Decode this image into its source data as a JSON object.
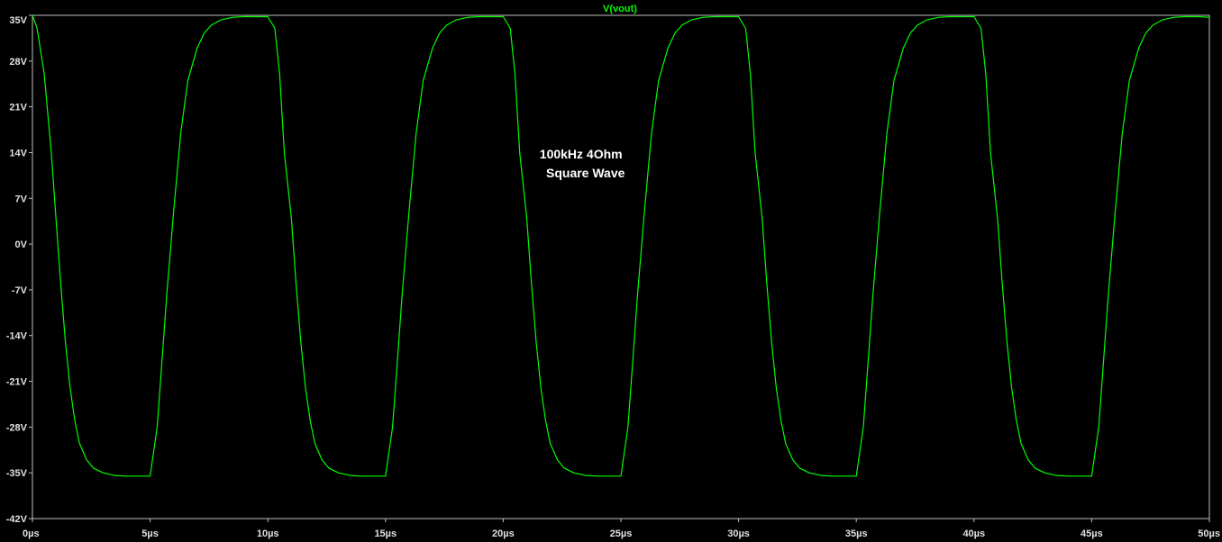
{
  "chart_data": {
    "type": "line",
    "title": "V(vout)",
    "annotation": [
      "100kHz 4Ohm",
      "Square Wave"
    ],
    "xlabel": "",
    "ylabel": "",
    "xlim": [
      0,
      50
    ],
    "ylim": [
      -42,
      35
    ],
    "x_ticks": [
      0,
      5,
      10,
      15,
      20,
      25,
      30,
      35,
      40,
      45,
      50
    ],
    "x_tick_labels": [
      "0µs",
      "5µs",
      "10µs",
      "15µs",
      "20µs",
      "25µs",
      "30µs",
      "35µs",
      "40µs",
      "45µs",
      "50µs"
    ],
    "y_ticks": [
      35,
      28,
      21,
      14,
      7,
      0,
      -7,
      -14,
      -21,
      -28,
      -35,
      -42
    ],
    "y_tick_labels": [
      "35V",
      "28V",
      "21V",
      "14V",
      "7V",
      "0V",
      "-7V",
      "-14V",
      "-21V",
      "-28V",
      "-35V",
      "-42V"
    ],
    "grid": false,
    "series": [
      {
        "color": "#00ff00",
        "x": [
          0,
          0.2,
          0.5,
          0.8,
          1.0,
          1.2,
          1.4,
          1.6,
          1.8,
          2.0,
          2.3,
          2.6,
          3.0,
          3.5,
          4.0,
          4.5,
          5.0,
          5.3,
          5.5,
          5.7,
          6.0,
          6.3,
          6.6,
          7.0,
          7.3,
          7.6,
          8.0,
          8.5,
          9.0,
          9.5,
          10.0,
          10.3,
          10.5,
          10.7,
          11.0,
          11.2,
          11.4,
          11.6,
          11.8,
          12.0,
          12.3,
          12.6,
          13.0,
          13.5,
          14.0,
          14.5,
          15.0,
          15.3,
          15.5,
          15.7,
          16.0,
          16.3,
          16.6,
          17.0,
          17.3,
          17.6,
          18.0,
          18.5,
          19.0,
          19.5,
          20.0,
          20.3,
          20.5,
          20.7,
          21.0,
          21.2,
          21.4,
          21.6,
          21.8,
          22.0,
          22.3,
          22.6,
          23.0,
          23.5,
          24.0,
          24.5,
          25.0,
          25.3,
          25.5,
          25.7,
          26.0,
          26.3,
          26.6,
          27.0,
          27.3,
          27.6,
          28.0,
          28.5,
          29.0,
          29.5,
          30.0,
          30.3,
          30.5,
          30.7,
          31.0,
          31.2,
          31.4,
          31.6,
          31.8,
          32.0,
          32.3,
          32.6,
          33.0,
          33.5,
          34.0,
          34.5,
          35.0,
          35.3,
          35.5,
          35.7,
          36.0,
          36.3,
          36.6,
          37.0,
          37.3,
          37.6,
          38.0,
          38.5,
          39.0,
          39.5,
          40.0,
          40.3,
          40.5,
          40.7,
          41.0,
          41.2,
          41.4,
          41.6,
          41.8,
          42.0,
          42.3,
          42.6,
          43.0,
          43.5,
          44.0,
          44.5,
          45.0,
          45.3,
          45.5,
          45.7,
          46.0,
          46.3,
          46.6,
          47.0,
          47.3,
          47.6,
          48.0,
          48.5,
          49.0,
          49.5,
          50.0
        ],
        "y": [
          35,
          33,
          26,
          14,
          4,
          -6,
          -15,
          -22,
          -27,
          -30.5,
          -33,
          -34.3,
          -35.0,
          -35.4,
          -35.5,
          -35.5,
          -35.5,
          -28,
          -18,
          -8,
          5,
          17,
          25,
          30,
          32.3,
          33.5,
          34.3,
          34.7,
          34.8,
          34.8,
          34.8,
          33,
          26,
          14,
          4,
          -6,
          -15,
          -22,
          -27,
          -30.5,
          -33,
          -34.3,
          -35.0,
          -35.4,
          -35.5,
          -35.5,
          -35.5,
          -28,
          -18,
          -8,
          5,
          17,
          25,
          30,
          32.3,
          33.5,
          34.3,
          34.7,
          34.8,
          34.8,
          34.8,
          33,
          26,
          14,
          4,
          -6,
          -15,
          -22,
          -27,
          -30.5,
          -33,
          -34.3,
          -35.0,
          -35.4,
          -35.5,
          -35.5,
          -35.5,
          -28,
          -18,
          -8,
          5,
          17,
          25,
          30,
          32.3,
          33.5,
          34.3,
          34.7,
          34.8,
          34.8,
          34.8,
          33,
          26,
          14,
          4,
          -6,
          -15,
          -22,
          -27,
          -30.5,
          -33,
          -34.3,
          -35.0,
          -35.4,
          -35.5,
          -35.5,
          -35.5,
          -28,
          -18,
          -8,
          5,
          17,
          25,
          30,
          32.3,
          33.5,
          34.3,
          34.7,
          34.8,
          34.8,
          34.8,
          33,
          26,
          14,
          4,
          -6,
          -15,
          -22,
          -27,
          -30.5,
          -33,
          -34.3,
          -35.0,
          -35.4,
          -35.5,
          -35.5,
          -35.5,
          -28,
          -18,
          -8,
          5,
          17,
          25,
          30,
          32.3,
          33.5,
          34.3,
          34.7,
          34.8,
          34.8,
          34.7
        ]
      }
    ]
  }
}
